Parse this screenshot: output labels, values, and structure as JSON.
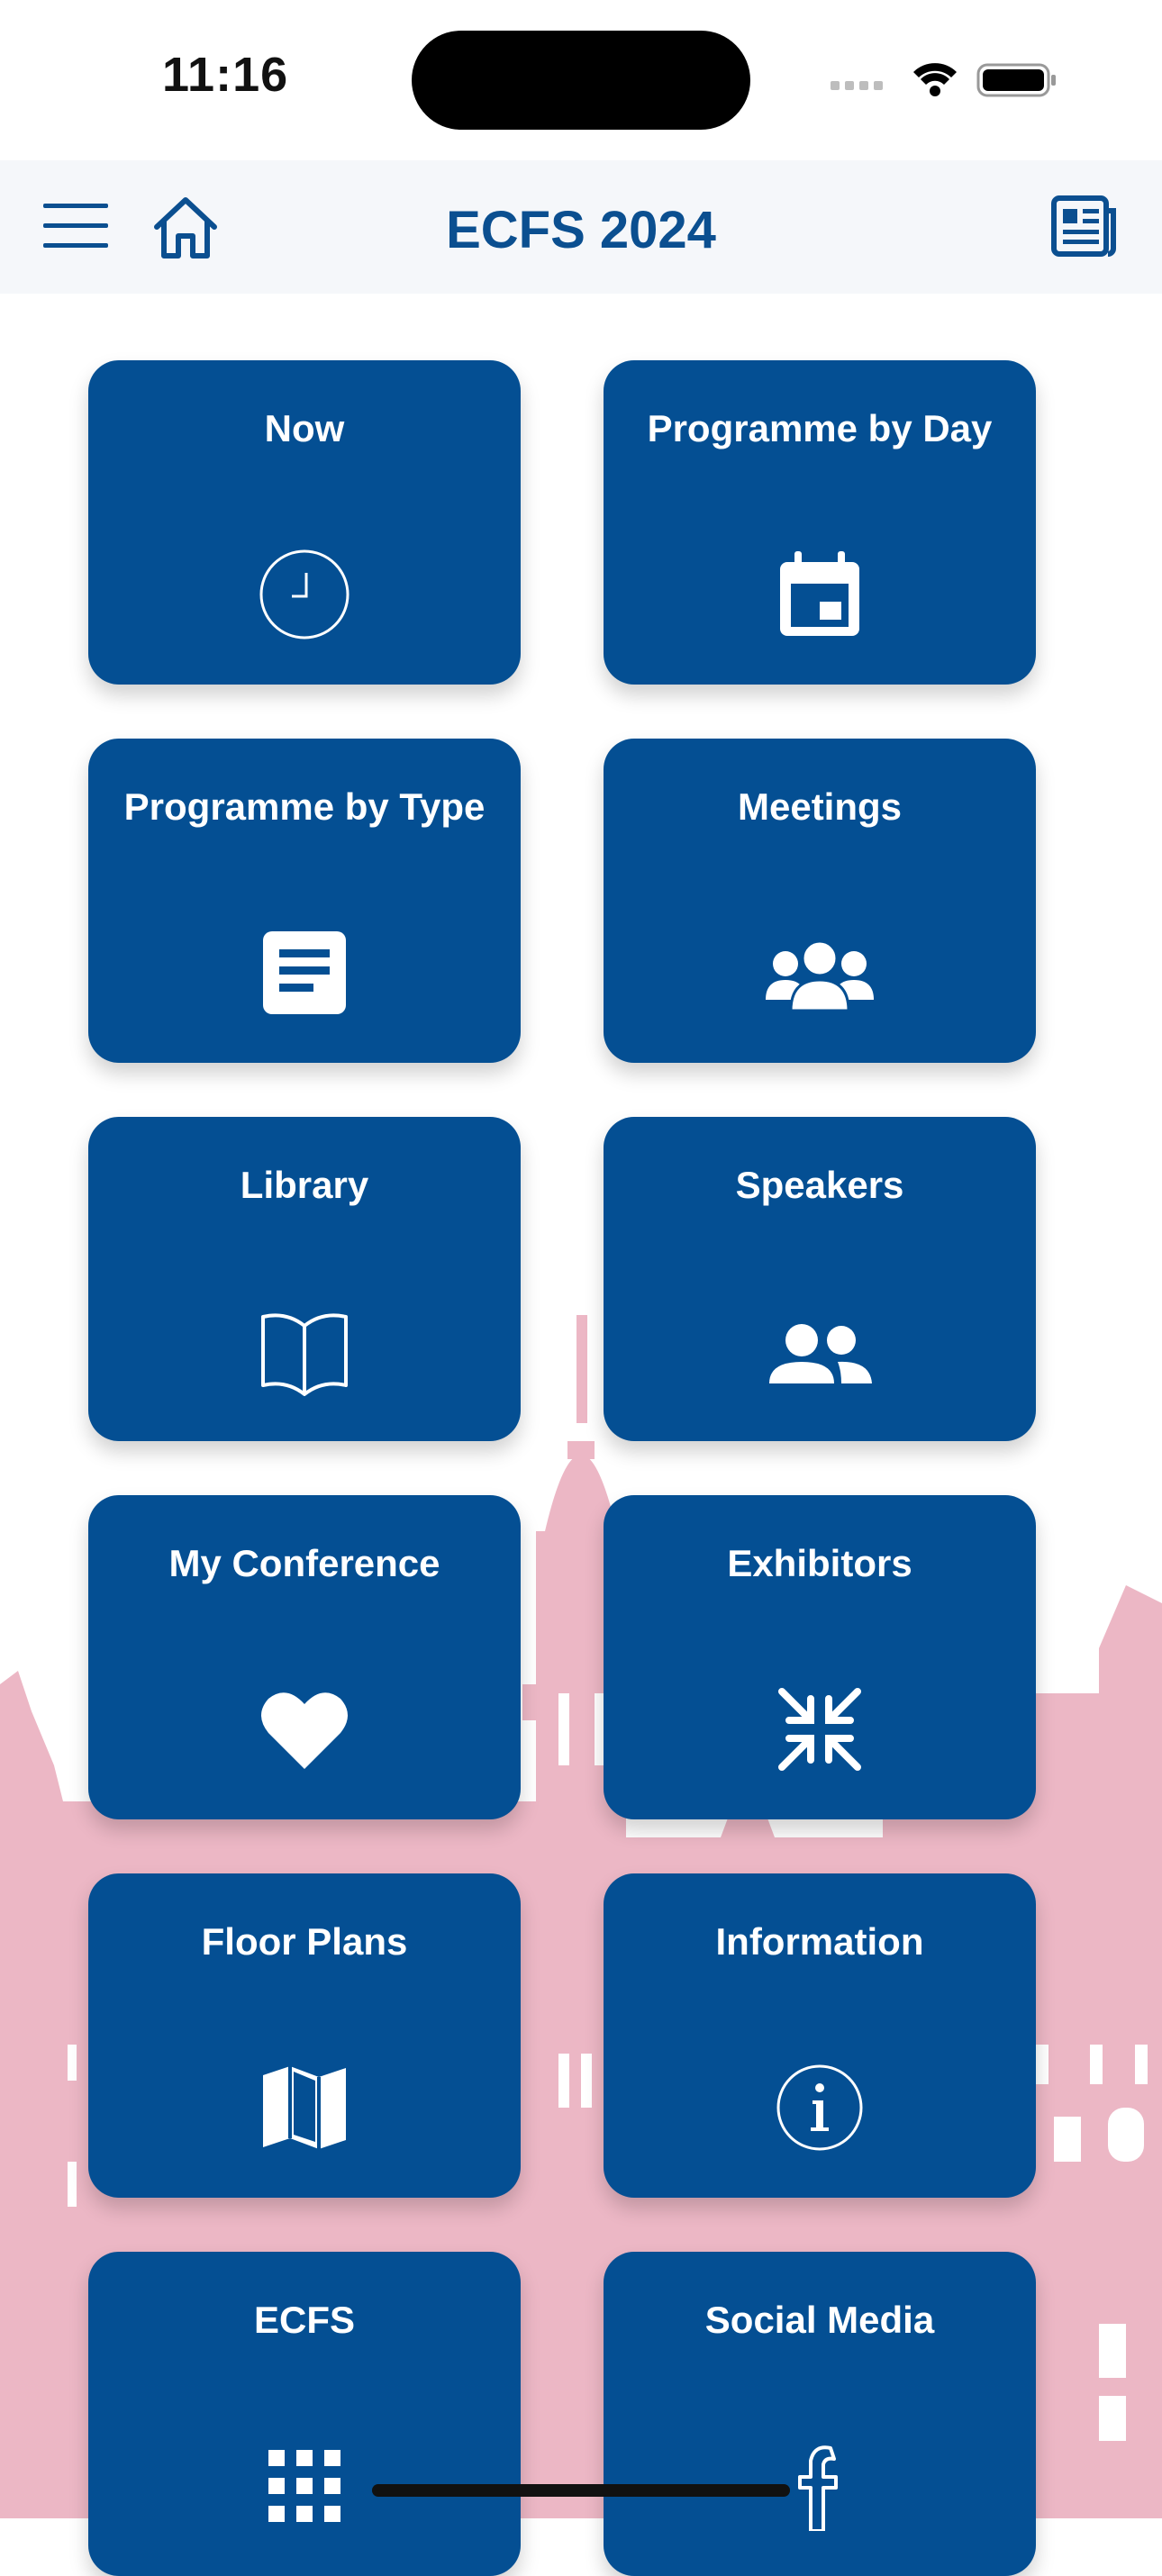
{
  "status_bar": {
    "time": "11:16"
  },
  "header": {
    "title": "ECFS 2024"
  },
  "tiles": [
    {
      "label": "Now",
      "icon": "clock-icon"
    },
    {
      "label": "Programme by Day",
      "icon": "calendar-icon"
    },
    {
      "label": "Programme by Type",
      "icon": "document-icon"
    },
    {
      "label": "Meetings",
      "icon": "group-icon"
    },
    {
      "label": "Library",
      "icon": "book-icon"
    },
    {
      "label": "Speakers",
      "icon": "people-icon"
    },
    {
      "label": "My Conference",
      "icon": "heart-icon"
    },
    {
      "label": "Exhibitors",
      "icon": "compress-icon"
    },
    {
      "label": "Floor Plans",
      "icon": "map-icon"
    },
    {
      "label": "Information",
      "icon": "info-icon"
    },
    {
      "label": "ECFS",
      "icon": "dots-grid-icon"
    },
    {
      "label": "Social Media",
      "icon": "facebook-icon"
    }
  ],
  "colors": {
    "tile_bg": "#044f93",
    "title": "#0b4f90",
    "skyline": "#ecb7c5"
  }
}
